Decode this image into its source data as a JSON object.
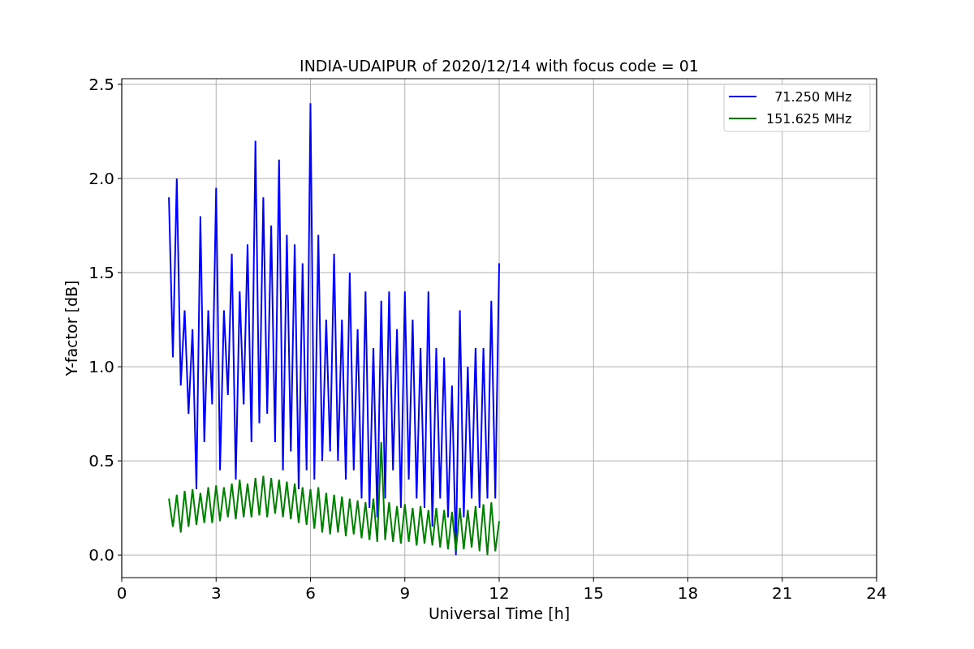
{
  "figure": {
    "chart_data": {
      "type": "line",
      "title": "INDIA-UDAIPUR of 2020/12/14 with focus code = 01",
      "xlabel": "Universal Time [h]",
      "ylabel": "Y-factor [dB]",
      "grid": true,
      "legend": true,
      "xlim": [
        0,
        24
      ],
      "ylim": [
        -0.12,
        2.53
      ],
      "xticks": [
        0,
        3,
        6,
        9,
        12,
        15,
        18,
        21,
        24
      ],
      "yticks": [
        {
          "value": 0,
          "label": "0.0"
        },
        {
          "value": 0.5,
          "label": "0.5"
        },
        {
          "value": 1,
          "label": "1.0"
        },
        {
          "value": 1.5,
          "label": "1.5"
        },
        {
          "value": 2,
          "label": "2.0"
        },
        {
          "value": 2.5,
          "label": "2.5"
        }
      ],
      "x": [
        1.5,
        1.625,
        1.75,
        1.875,
        2,
        2.125,
        2.25,
        2.375,
        2.5,
        2.625,
        2.75,
        2.875,
        3,
        3.125,
        3.25,
        3.375,
        3.5,
        3.625,
        3.75,
        3.875,
        4,
        4.125,
        4.25,
        4.375,
        4.5,
        4.625,
        4.75,
        4.875,
        5,
        5.125,
        5.25,
        5.375,
        5.5,
        5.625,
        5.75,
        5.875,
        6,
        6.125,
        6.25,
        6.375,
        6.5,
        6.625,
        6.75,
        6.875,
        7,
        7.125,
        7.25,
        7.375,
        7.5,
        7.625,
        7.75,
        7.875,
        8,
        8.125,
        8.25,
        8.375,
        8.5,
        8.625,
        8.75,
        8.875,
        9,
        9.125,
        9.25,
        9.375,
        9.5,
        9.625,
        9.75,
        9.875,
        10,
        10.125,
        10.25,
        10.375,
        10.5,
        10.625,
        10.75,
        10.875,
        11,
        11.125,
        11.25,
        11.375,
        11.5,
        11.625,
        11.75,
        11.875,
        12
      ],
      "series": [
        {
          "name": "  71.250 MHz",
          "color": "#0000ff",
          "values": [
            1.9,
            1.05,
            2.0,
            0.9,
            1.3,
            0.75,
            1.2,
            0.35,
            1.8,
            0.6,
            1.3,
            0.8,
            1.95,
            0.45,
            1.3,
            0.85,
            1.6,
            0.4,
            1.4,
            0.8,
            1.65,
            0.6,
            2.2,
            0.7,
            1.9,
            0.75,
            1.75,
            0.6,
            2.1,
            0.45,
            1.7,
            0.55,
            1.65,
            0.35,
            1.55,
            0.45,
            2.4,
            0.4,
            1.7,
            0.5,
            1.25,
            0.55,
            1.6,
            0.5,
            1.25,
            0.4,
            1.5,
            0.45,
            1.2,
            0.3,
            1.4,
            0.25,
            1.1,
            0.2,
            1.35,
            0.3,
            1.4,
            0.45,
            1.2,
            0.25,
            1.4,
            0.4,
            1.25,
            0.3,
            1.1,
            0.25,
            1.4,
            0.15,
            1.1,
            0.3,
            1.05,
            0.2,
            0.9,
            0.0,
            1.3,
            0.2,
            1.0,
            0.3,
            1.1,
            0.25,
            1.1,
            0.3,
            1.35,
            0.3,
            1.55
          ]
        },
        {
          "name": "151.625 MHz",
          "color": "#008000",
          "values": [
            0.3,
            0.15,
            0.32,
            0.12,
            0.34,
            0.15,
            0.35,
            0.16,
            0.33,
            0.17,
            0.36,
            0.17,
            0.37,
            0.18,
            0.36,
            0.2,
            0.38,
            0.19,
            0.4,
            0.2,
            0.38,
            0.2,
            0.41,
            0.21,
            0.42,
            0.2,
            0.41,
            0.22,
            0.4,
            0.2,
            0.39,
            0.19,
            0.38,
            0.17,
            0.36,
            0.16,
            0.35,
            0.14,
            0.36,
            0.12,
            0.33,
            0.11,
            0.32,
            0.12,
            0.31,
            0.1,
            0.3,
            0.11,
            0.29,
            0.09,
            0.28,
            0.08,
            0.3,
            0.07,
            0.6,
            0.08,
            0.28,
            0.07,
            0.26,
            0.06,
            0.27,
            0.07,
            0.25,
            0.05,
            0.26,
            0.06,
            0.24,
            0.05,
            0.25,
            0.04,
            0.24,
            0.03,
            0.23,
            0.02,
            0.25,
            0.03,
            0.24,
            0.04,
            0.26,
            0.02,
            0.27,
            0.0,
            0.28,
            0.02,
            0.18
          ]
        }
      ]
    }
  }
}
